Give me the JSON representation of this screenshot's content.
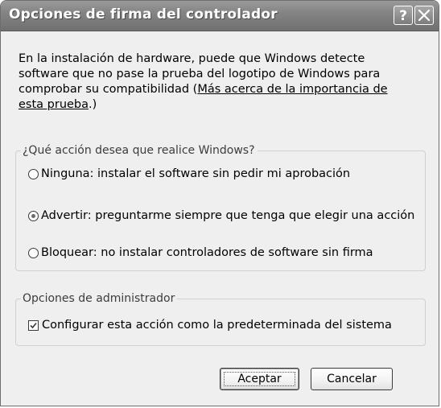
{
  "window": {
    "title": "Opciones de firma del controlador",
    "help_symbol": "?",
    "close_icon": "close-icon",
    "help_icon": "help-icon"
  },
  "intro": {
    "text_before": "En la instalación de hardware, puede que Windows detecte software que no pase la prueba del logotipo de Windows para comprobar su compatibilidad (",
    "link_text": "Más acerca de la importancia de esta prueba",
    "text_after": ".)"
  },
  "action_group": {
    "legend": "¿Qué acción desea que realice Windows?",
    "options": [
      {
        "label": "Ninguna: instalar el software sin pedir mi aprobación",
        "selected": false
      },
      {
        "label": "Advertir: preguntarme siempre que tenga que elegir una acción",
        "selected": true
      },
      {
        "label": "Bloquear: no instalar controladores de software sin firma",
        "selected": false
      }
    ]
  },
  "admin_group": {
    "legend": "Opciones de administrador",
    "checkbox_label": "Configurar esta acción como la predeterminada del sistema",
    "checked": true
  },
  "buttons": {
    "ok_label": "Aceptar",
    "cancel_label": "Cancelar"
  },
  "colors": {
    "titlebar": "#848484",
    "window_bg": "#efefef",
    "border": "#6e6e6e"
  }
}
